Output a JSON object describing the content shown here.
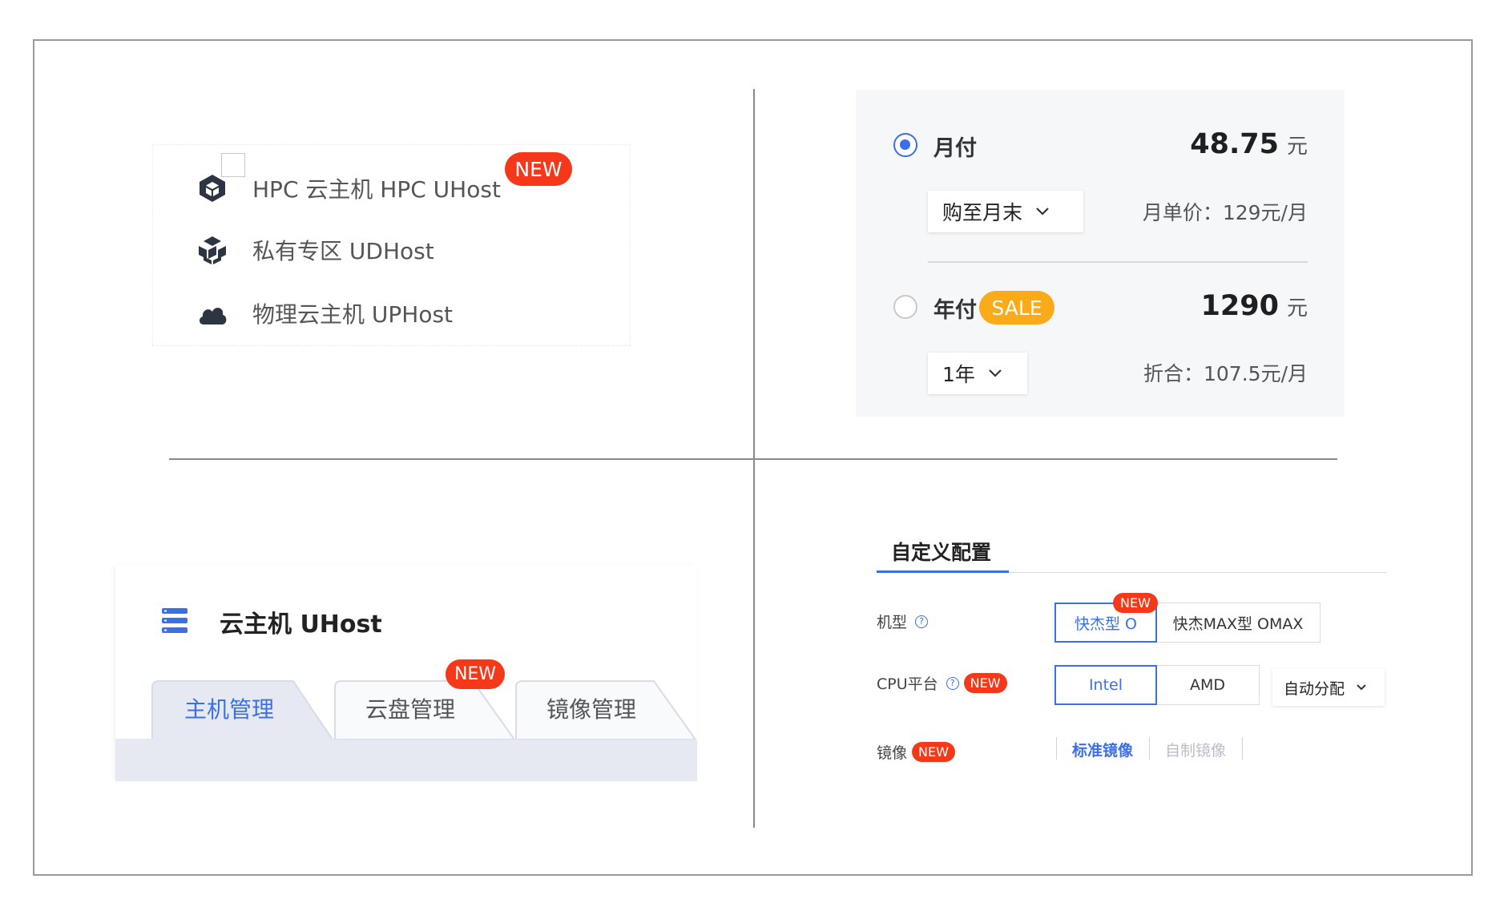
{
  "q1_product_list": {
    "items": [
      {
        "label": "HPC 云主机 HPC UHost",
        "icon": "hexagon-cube-icon"
      },
      {
        "label": "私有专区 UDHost",
        "icon": "cubes-icon"
      },
      {
        "label": "物理云主机 UPHost",
        "icon": "cloud-icon"
      }
    ],
    "new_badge": "NEW"
  },
  "q2_pricing": {
    "monthly": {
      "label": "月付",
      "amount": "48.75",
      "unit": "元",
      "selected": true,
      "duration": "购至月末",
      "note": "月单价：129元/月"
    },
    "yearly": {
      "label": "年付",
      "badge": "SALE",
      "amount": "1290",
      "unit": "元",
      "selected": false,
      "duration": "1年",
      "note": "折合：107.5元/月"
    }
  },
  "q3_uhost": {
    "title": "云主机 UHost",
    "tabs": [
      "主机管理",
      "云盘管理",
      "镜像管理"
    ],
    "new_badge": "NEW"
  },
  "q4_config": {
    "tab": "自定义配置",
    "model": {
      "label": "机型",
      "options": [
        "快杰型 O",
        "快杰MAX型 OMAX"
      ],
      "new_badge": "NEW"
    },
    "cpu": {
      "label": "CPU平台",
      "new_badge": "NEW",
      "options": [
        "Intel",
        "AMD"
      ],
      "auto": "自动分配"
    },
    "image": {
      "label": "镜像",
      "new_badge": "NEW",
      "options": [
        "标准镜像",
        "自制镜像"
      ]
    }
  },
  "colors": {
    "accent": "#3b6fe8",
    "new_badge": "#f5371a",
    "sale_badge": "#fbaa1a",
    "icon_dark": "#2d3542"
  }
}
